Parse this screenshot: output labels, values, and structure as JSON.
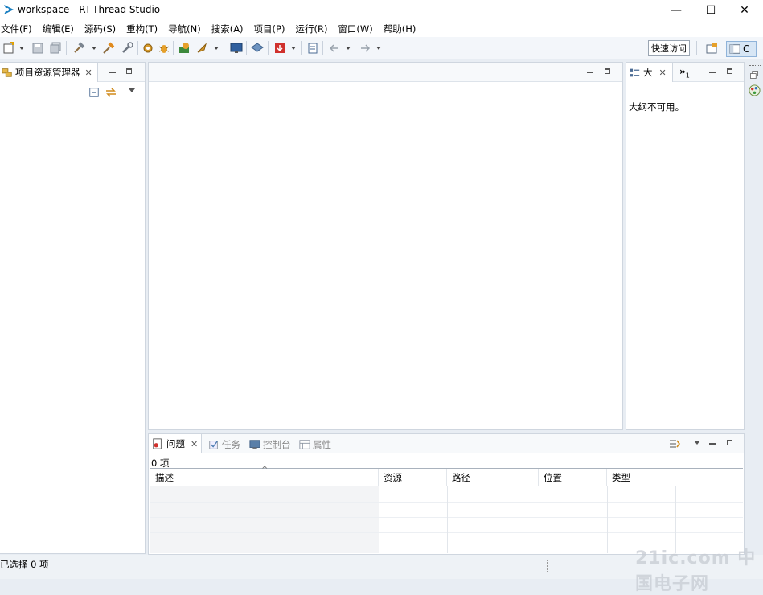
{
  "window": {
    "title": "workspace - RT-Thread Studio",
    "controls": {
      "minimize": "—",
      "maximize": "☐",
      "close": "✕"
    }
  },
  "menu": {
    "items": [
      "文件(F)",
      "编辑(E)",
      "源码(S)",
      "重构(T)",
      "导航(N)",
      "搜索(A)",
      "项目(P)",
      "运行(R)",
      "窗口(W)",
      "帮助(H)"
    ]
  },
  "toolbar": {
    "quick_access": "快速访问",
    "perspective_label": "C"
  },
  "project_explorer": {
    "tab_label": "项目资源管理器"
  },
  "outline": {
    "tab_label": "大",
    "overflow_label": "»",
    "overflow_count": "1",
    "message": "大纲不可用。"
  },
  "bottom_panel": {
    "tabs": [
      "问题",
      "任务",
      "控制台",
      "属性"
    ],
    "count_text": "0 项",
    "columns": [
      "描述",
      "资源",
      "路径",
      "位置",
      "类型"
    ],
    "sort_indicator": "^"
  },
  "status": {
    "text": "已选择 0 项"
  },
  "watermark": {
    "text": "21ic.com 中国电子网"
  }
}
